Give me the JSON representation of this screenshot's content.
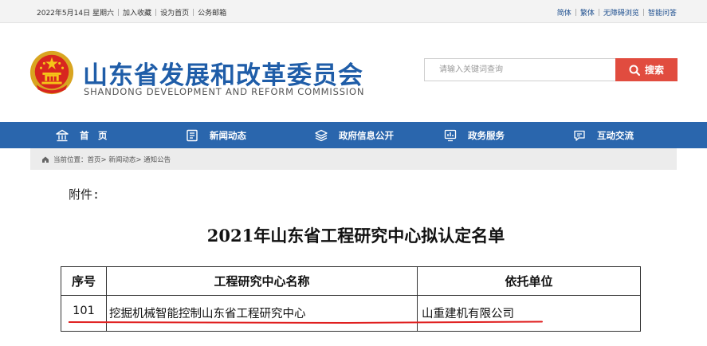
{
  "topbar": {
    "date": "2022年5月14日 星期六",
    "add_favorite": "加入收藏",
    "set_homepage": "设为首页",
    "public_email": "公务邮箱",
    "simplified": "简体",
    "traditional": "繁体",
    "accessibility": "无障碍浏览",
    "smart_qa": "智能问答"
  },
  "header": {
    "title": "山东省发展和改革委员会",
    "subtitle": "SHANDONG DEVELOPMENT AND REFORM COMMISSION",
    "emblem_icon": "national-emblem-icon"
  },
  "search": {
    "placeholder": "请输入关键词查询",
    "button_label": "搜索"
  },
  "nav": {
    "items": [
      {
        "label": "首　页",
        "icon": "home-icon"
      },
      {
        "label": "新闻动态",
        "icon": "news-icon"
      },
      {
        "label": "政府信息公开",
        "icon": "layers-icon"
      },
      {
        "label": "政务服务",
        "icon": "chart-icon"
      },
      {
        "label": "互动交流",
        "icon": "chat-icon"
      }
    ]
  },
  "breadcrumb": {
    "text": "当前位置：首页> 新闻动态> 通知公告"
  },
  "document": {
    "attachment_label": "附件:",
    "title": "2021年山东省工程研究中心拟认定名单",
    "table": {
      "headers": [
        "序号",
        "工程研究中心名称",
        "依托单位"
      ],
      "rows": [
        [
          "101",
          "挖掘机械智能控制山东省工程研究中心",
          "山重建机有限公司"
        ]
      ]
    }
  },
  "colors": {
    "brand_blue": "#2a66ad",
    "title_blue": "#1f5da8",
    "search_red": "#e14c3f",
    "annotation_red": "#e02020"
  }
}
